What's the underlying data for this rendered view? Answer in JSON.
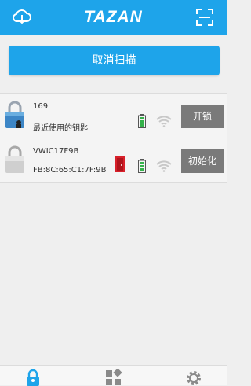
{
  "header": {
    "brand": "TAZAN",
    "left_icon": "cloud-download-icon",
    "right_icon": "scan-frame-icon",
    "color": "#1ea4ea"
  },
  "cancel_scan_label": "取消扫描",
  "devices": [
    {
      "name": "169",
      "subtitle": "最近使用的钥匙",
      "action": "开锁",
      "icon": "padlock-recent-icon",
      "battery": "full",
      "signal": "wifi"
    },
    {
      "name": "VWIC17F9B",
      "subtitle": "FB:8C:65:C1:7F:9B",
      "action": "初始化",
      "icon": "padlock-icon",
      "battery": "full",
      "signal": "wifi",
      "door_status": "red-door"
    }
  ],
  "tabs": [
    {
      "icon": "lock-icon",
      "active": true
    },
    {
      "icon": "apps-grid-icon",
      "active": false
    },
    {
      "icon": "settings-gear-icon",
      "active": false
    }
  ]
}
